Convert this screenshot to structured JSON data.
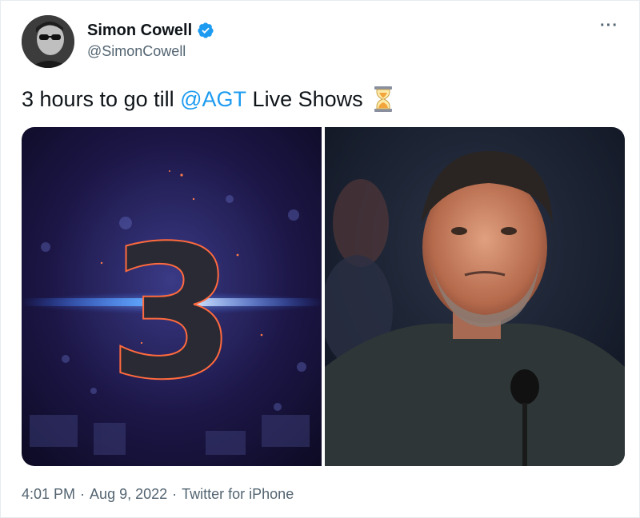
{
  "tweet": {
    "display_name": "Simon Cowell",
    "handle": "@SimonCowell",
    "more_label": "···",
    "text_before": "3 hours to go till ",
    "mention": "@AGT",
    "text_after": " Live Shows",
    "emoji_icon": "hourglass-icon",
    "verified_icon": "verified-badge-icon",
    "images": [
      {
        "name": "countdown-image",
        "big_number": "3"
      },
      {
        "name": "judge-photo"
      }
    ],
    "time": "4:01 PM",
    "separator": "·",
    "date": "Aug 9, 2022",
    "source": "Twitter for iPhone"
  },
  "colors": {
    "link": "#1d9bf0",
    "secondary_text": "#536471",
    "verified": "#1d9bf0"
  }
}
